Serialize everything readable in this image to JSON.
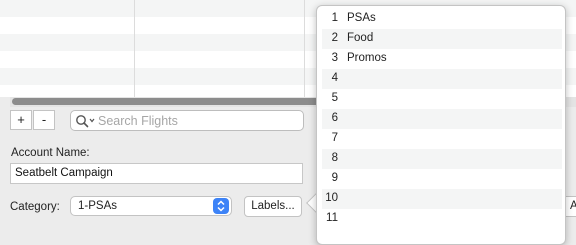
{
  "toolbar": {
    "add_label": "+",
    "remove_label": "-"
  },
  "search": {
    "placeholder": "Search Flights",
    "icon": "search-icon"
  },
  "account": {
    "label": "Account Name:",
    "value": "Seatbelt Campaign"
  },
  "category": {
    "label": "Category:",
    "selected": "1-PSAs"
  },
  "labels_button": {
    "label": "Labels..."
  },
  "right_button": {
    "label": "A"
  },
  "labels_popover": {
    "items": [
      {
        "num": "1",
        "name": "PSAs"
      },
      {
        "num": "2",
        "name": "Food"
      },
      {
        "num": "3",
        "name": "Promos"
      },
      {
        "num": "4",
        "name": ""
      },
      {
        "num": "5",
        "name": ""
      },
      {
        "num": "6",
        "name": ""
      },
      {
        "num": "7",
        "name": ""
      },
      {
        "num": "8",
        "name": ""
      },
      {
        "num": "9",
        "name": ""
      },
      {
        "num": "10",
        "name": ""
      },
      {
        "num": "11",
        "name": ""
      }
    ]
  },
  "colors": {
    "accent": "#3d83f7",
    "row_alt": "#f4f5f5",
    "window_bg": "#ececec"
  }
}
